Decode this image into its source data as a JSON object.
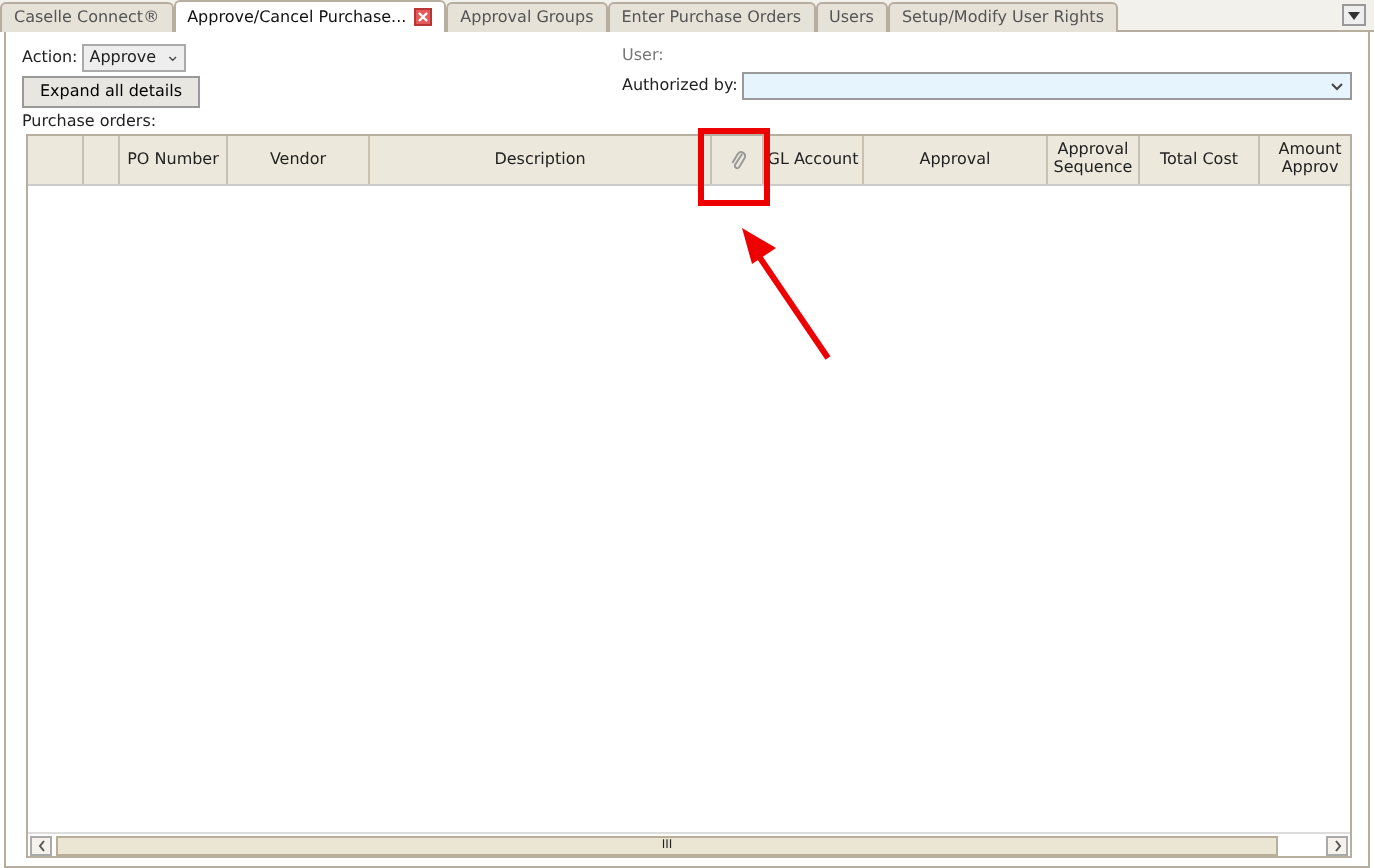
{
  "tabs": [
    {
      "label": "Caselle Connect®",
      "selected": false,
      "closable": false
    },
    {
      "label": "Approve/Cancel Purchase...",
      "selected": true,
      "closable": true
    },
    {
      "label": "Approval Groups",
      "selected": false,
      "closable": false
    },
    {
      "label": "Enter Purchase Orders",
      "selected": false,
      "closable": false
    },
    {
      "label": "Users",
      "selected": false,
      "closable": false
    },
    {
      "label": "Setup/Modify User Rights",
      "selected": false,
      "closable": false
    }
  ],
  "action": {
    "label": "Action:",
    "value": "Approve"
  },
  "expand_button": "Expand all details",
  "user_label": "User:",
  "authorized_by": {
    "label": "Authorized by:"
  },
  "purchase_orders_label": "Purchase orders:",
  "columns": [
    {
      "kind": "blank"
    },
    {
      "kind": "blank"
    },
    {
      "kind": "text",
      "label": "PO Number"
    },
    {
      "kind": "text",
      "label": "Vendor"
    },
    {
      "kind": "text",
      "label": "Description"
    },
    {
      "kind": "attachment"
    },
    {
      "kind": "text",
      "label": "GL Account"
    },
    {
      "kind": "text",
      "label": "Approval"
    },
    {
      "kind": "text",
      "label": "Approval Sequence"
    },
    {
      "kind": "text",
      "label": "Total Cost"
    },
    {
      "kind": "text",
      "label": "Amount Approv"
    }
  ],
  "scrollbar_grip": "III"
}
